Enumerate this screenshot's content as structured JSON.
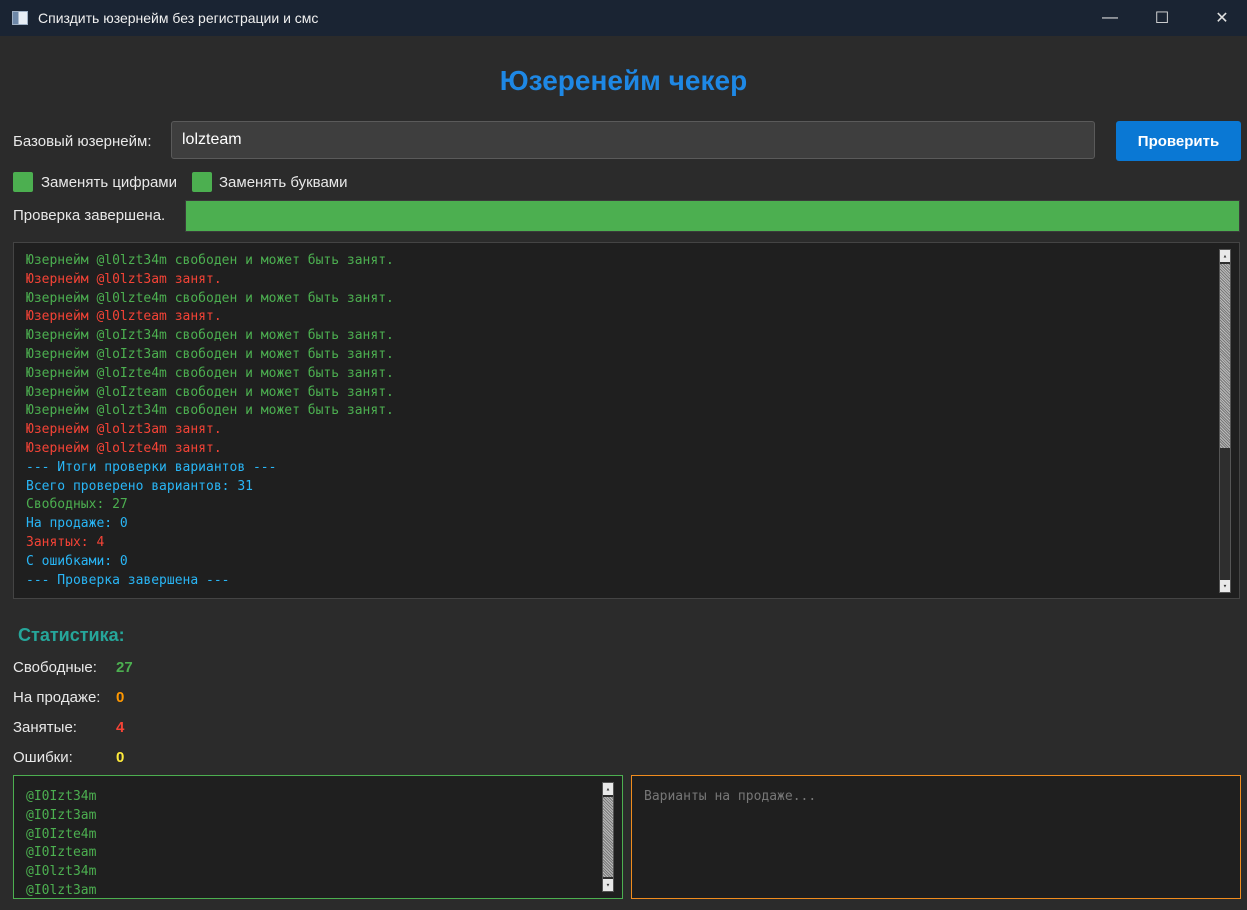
{
  "window": {
    "title": "Спиздить юзернейм без регистрации и смс",
    "minimize": "—",
    "maximize": "☐",
    "close": "✕"
  },
  "header": {
    "title": "Юзеренейм чекер"
  },
  "form": {
    "base_label": "Базовый юзернейм:",
    "base_value": "lolzteam",
    "check_button": "Проверить",
    "replace_digits_label": "Заменять цифрами",
    "replace_letters_label": "Заменять буквами"
  },
  "progress": {
    "status": "Проверка завершена.",
    "percent": 100
  },
  "log": {
    "lines": [
      {
        "text": "Юзернейм @l0lzt34m свободен и может быть занят.",
        "kind": "free"
      },
      {
        "text": "Юзернейм @l0lzt3am занят.",
        "kind": "taken"
      },
      {
        "text": "Юзернейм @l0lzte4m свободен и может быть занят.",
        "kind": "free"
      },
      {
        "text": "Юзернейм @l0lzteam занят.",
        "kind": "taken"
      },
      {
        "text": "Юзернейм @loIzt34m свободен и может быть занят.",
        "kind": "free"
      },
      {
        "text": "Юзернейм @loIzt3am свободен и может быть занят.",
        "kind": "free"
      },
      {
        "text": "Юзернейм @loIzte4m свободен и может быть занят.",
        "kind": "free"
      },
      {
        "text": "Юзернейм @loIzteam свободен и может быть занят.",
        "kind": "free"
      },
      {
        "text": "Юзернейм @lolzt34m свободен и может быть занят.",
        "kind": "free"
      },
      {
        "text": "Юзернейм @lolzt3am занят.",
        "kind": "taken"
      },
      {
        "text": "Юзернейм @lolzte4m занят.",
        "kind": "taken"
      },
      {
        "text": "--- Итоги проверки вариантов ---",
        "kind": "info"
      },
      {
        "text": "Всего проверено вариантов: 31",
        "kind": "info"
      },
      {
        "text": "Свободных: 27",
        "kind": "free"
      },
      {
        "text": "На продаже: 0",
        "kind": "info"
      },
      {
        "text": "Занятых: 4",
        "kind": "taken"
      },
      {
        "text": "С ошибками: 0",
        "kind": "info"
      },
      {
        "text": "--- Проверка завершена ---",
        "kind": "info"
      }
    ]
  },
  "stats": {
    "title": "Статистика:",
    "free_label": "Свободные:",
    "free_value": "27",
    "sale_label": "На продаже:",
    "sale_value": "0",
    "taken_label": "Занятые:",
    "taken_value": "4",
    "errors_label": "Ошибки:",
    "errors_value": "0"
  },
  "free_list": {
    "items": [
      "@I0Izt34m",
      "@I0Izt3am",
      "@I0Izte4m",
      "@I0Izteam",
      "@I0lzt34m",
      "@I0lzt3am"
    ]
  },
  "sale_list": {
    "placeholder": "Варианты на продаже..."
  },
  "colors": {
    "free": "#4caf50",
    "taken": "#f44336",
    "info": "#29b6f6",
    "sale": "#ff9800",
    "errors": "#ffeb3b"
  }
}
